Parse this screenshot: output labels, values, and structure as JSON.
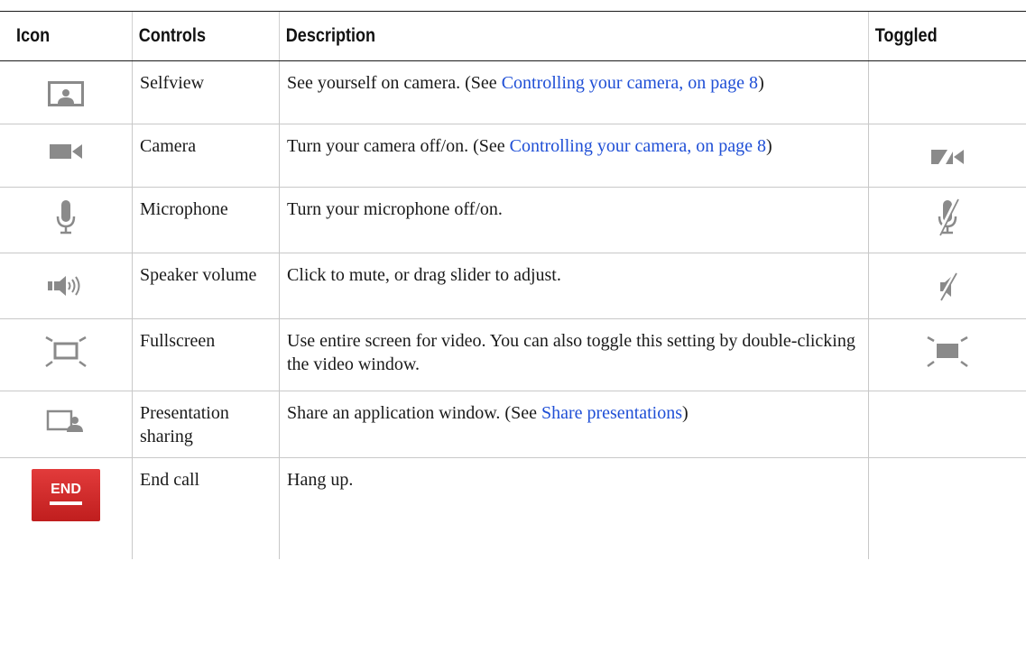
{
  "headers": {
    "icon": "Icon",
    "controls": "Controls",
    "description": "Description",
    "toggled": "Toggled"
  },
  "rows": [
    {
      "icon": "selfview-icon",
      "control": "Selfview",
      "desc_before": "See yourself on camera. (See ",
      "link": "Controlling your camera,  on page 8",
      "desc_after": ")",
      "toggled_icon": ""
    },
    {
      "icon": "camera-icon",
      "control": "Camera",
      "desc_before": "Turn your camera off/on. (See ",
      "link": "Controlling your camera,  on page 8",
      "desc_after": ")",
      "toggled_icon": "camera-off-icon"
    },
    {
      "icon": "microphone-icon",
      "control": "Microphone",
      "desc_before": "Turn your microphone off/on.",
      "link": "",
      "desc_after": "",
      "toggled_icon": "microphone-muted-icon"
    },
    {
      "icon": "speaker-volume-icon",
      "control": "Speaker volume",
      "desc_before": "Click to mute, or drag slider to adjust.",
      "link": "",
      "desc_after": "",
      "toggled_icon": "speaker-muted-icon"
    },
    {
      "icon": "fullscreen-icon",
      "control": "Fullscreen",
      "desc_before": "Use entire screen for video. You can also toggle this setting by double-clicking the video window.",
      "link": "",
      "desc_after": "",
      "toggled_icon": "exit-fullscreen-icon"
    },
    {
      "icon": "presentation-sharing-icon",
      "control": "Presentation sharing",
      "desc_before": "Share an application window. (See ",
      "link": "Share presentations",
      "desc_after": ")",
      "toggled_icon": ""
    },
    {
      "icon": "end-call-icon",
      "icon_text": "END",
      "control": "End call",
      "desc_before": "Hang up.",
      "link": "",
      "desc_after": "",
      "toggled_icon": ""
    }
  ],
  "colors": {
    "icon_gray": "#8a8a8a",
    "link_blue": "#1f4fd6",
    "end_red": "#d42a2a"
  }
}
